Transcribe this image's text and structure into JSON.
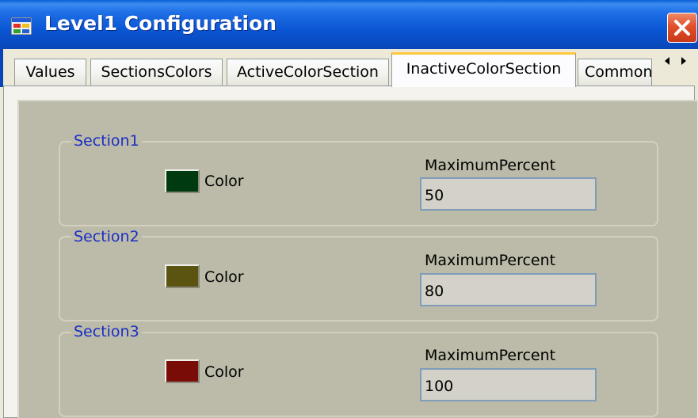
{
  "window": {
    "title": "Level1 Configuration",
    "title_color": "#ffffff",
    "titlebar_color": "#0b56d4",
    "close_button_color": "#e0502a"
  },
  "tabs": [
    {
      "label": "Values",
      "active": false
    },
    {
      "label": "SectionsColors",
      "active": false
    },
    {
      "label": "ActiveColorSection",
      "active": false
    },
    {
      "label": "InactiveColorSection",
      "active": true
    },
    {
      "label": "Common",
      "active": false
    }
  ],
  "tab_scroll": {
    "left_icon": "arrow-left",
    "right_icon": "arrow-right"
  },
  "sections": [
    {
      "legend": "Section1",
      "color_label": "Color",
      "swatch_color": "#003a10",
      "max_label": "MaximumPercent",
      "max_value": "50"
    },
    {
      "legend": "Section2",
      "color_label": "Color",
      "swatch_color": "#5a5410",
      "max_label": "MaximumPercent",
      "max_value": "80"
    },
    {
      "legend": "Section3",
      "color_label": "Color",
      "swatch_color": "#7a0c08",
      "max_label": "MaximumPercent",
      "max_value": "100"
    }
  ],
  "colors": {
    "legend_text": "#1a2fc4",
    "panel_bg": "#bcbaa8",
    "active_tab_highlight": "#ffc83c"
  }
}
